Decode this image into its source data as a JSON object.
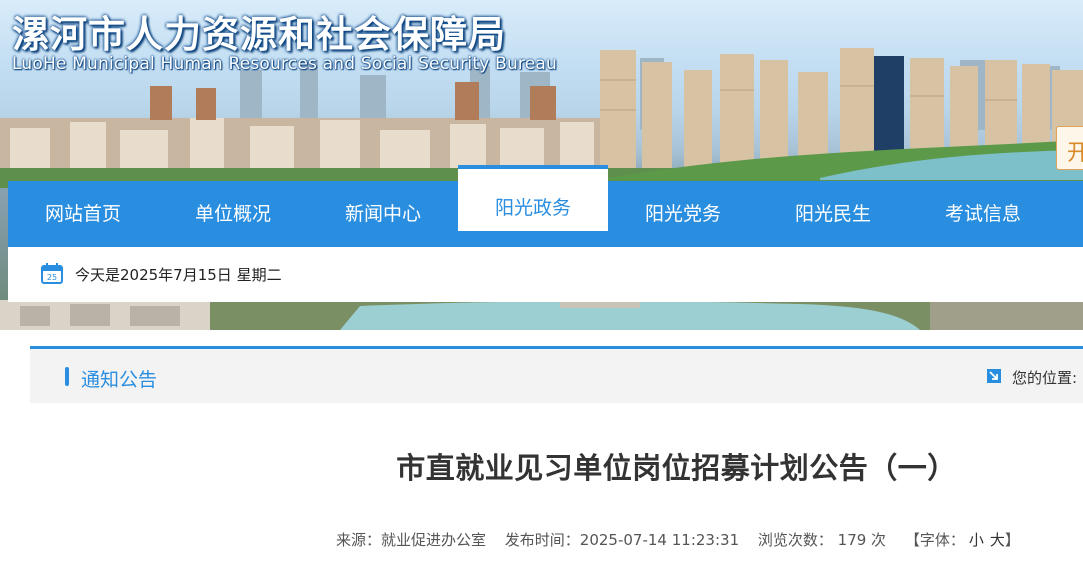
{
  "site": {
    "title": "漯河市人力资源和社会保障局",
    "subtitle": "LuoHe Municipal Human Resources and Social Security Bureau",
    "corner_char": "开"
  },
  "nav": {
    "items": [
      {
        "label": "网站首页",
        "active": false
      },
      {
        "label": "单位概况",
        "active": false
      },
      {
        "label": "新闻中心",
        "active": false
      },
      {
        "label": "阳光政务",
        "active": true
      },
      {
        "label": "阳光党务",
        "active": false
      },
      {
        "label": "阳光民生",
        "active": false
      },
      {
        "label": "考试信息",
        "active": false
      }
    ]
  },
  "datebar": {
    "icon": "calendar-icon",
    "icon_day": "25",
    "text": "今天是2025年7月15日 星期二"
  },
  "panel": {
    "section_title": "通知公告",
    "location_label": "您的位置:",
    "location_icon": "arrow-location-icon"
  },
  "article": {
    "title": "市直就业见习单位岗位招募计划公告（一）",
    "source": "来源：就业促进办公室",
    "published": "发布时间：2025-07-14 11:23:31",
    "views": "浏览次数：  179  次",
    "font_label": "【字体：",
    "font_small": "小",
    "font_large": "大",
    "font_close": "】"
  },
  "colors": {
    "accent": "#2a8ee0",
    "nav_text": "#ffffff",
    "panel_head_bg": "#f3f3f3"
  }
}
